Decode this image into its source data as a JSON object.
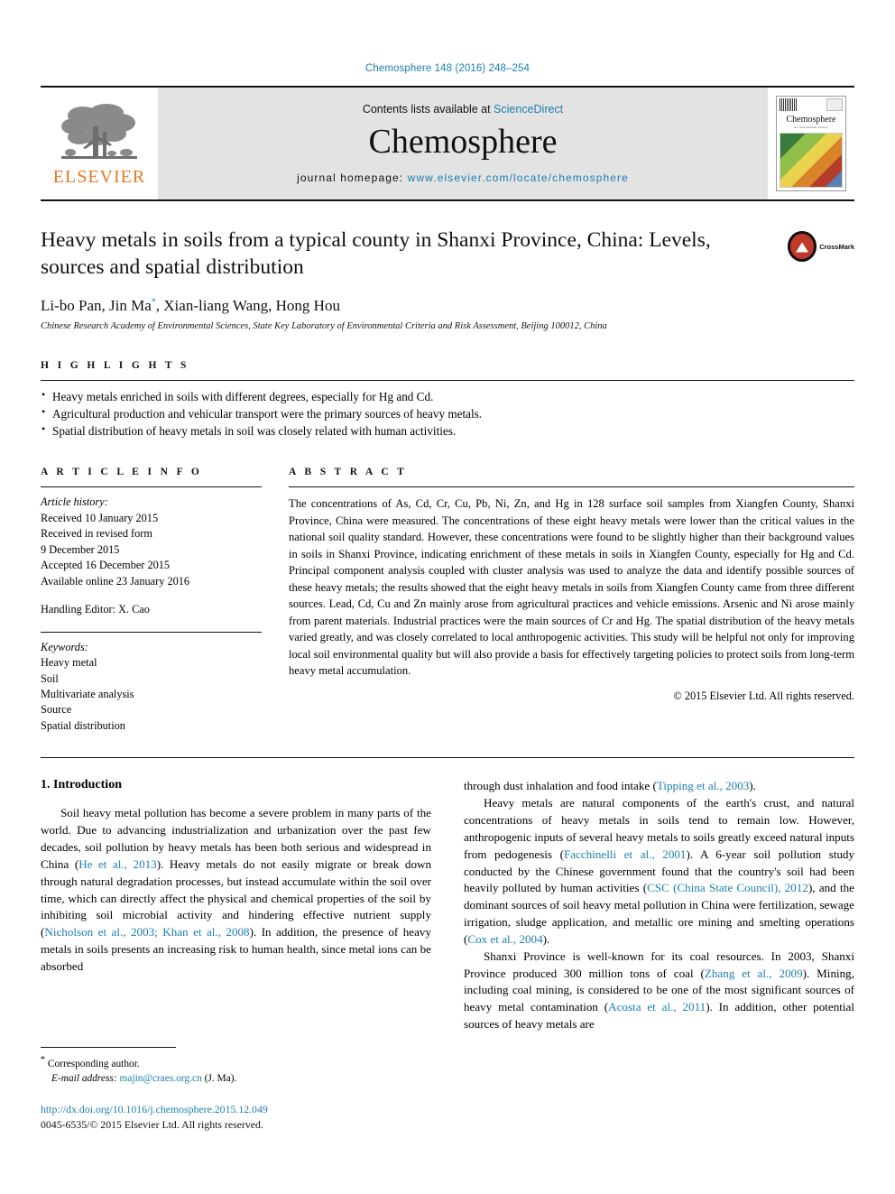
{
  "running_head": "Chemosphere 148 (2016) 248–254",
  "masthead": {
    "publisher_name": "ELSEVIER",
    "contents_prefix": "Contents lists available at ",
    "contents_link": "ScienceDirect",
    "journal_name": "Chemosphere",
    "homepage_prefix": "journal homepage: ",
    "homepage_url": "www.elsevier.com/locate/chemosphere",
    "cover_title": "Chemosphere",
    "cover_subtitle": "An International Journal"
  },
  "article": {
    "title": "Heavy metals in soils from a typical county in Shanxi Province, China: Levels, sources and spatial distribution",
    "authors": "Li-bo Pan, Jin Ma",
    "authors_tail": ", Xian-liang Wang, Hong Hou",
    "author_marker": "*",
    "affiliation": "Chinese Research Academy of Environmental Sciences, State Key Laboratory of Environmental Criteria and Risk Assessment, Beijing 100012, China",
    "crossmark_label": "CrossMark"
  },
  "highlights": {
    "label": "H I G H L I G H T S",
    "items": [
      "Heavy metals enriched in soils with different degrees, especially for Hg and Cd.",
      "Agricultural production and vehicular transport were the primary sources of heavy metals.",
      "Spatial distribution of heavy metals in soil was closely related with human activities."
    ]
  },
  "article_info": {
    "label": "A R T I C L E   I N F O",
    "history_label": "Article history:",
    "history": [
      "Received 10 January 2015",
      "Received in revised form",
      "9 December 2015",
      "Accepted 16 December 2015",
      "Available online 23 January 2016"
    ],
    "handling_editor": "Handling Editor: X. Cao",
    "keywords_label": "Keywords:",
    "keywords": [
      "Heavy metal",
      "Soil",
      "Multivariate analysis",
      "Source",
      "Spatial distribution"
    ]
  },
  "abstract": {
    "label": "A B S T R A C T",
    "text": "The concentrations of As, Cd, Cr, Cu, Pb, Ni, Zn, and Hg in 128 surface soil samples from Xiangfen County, Shanxi Province, China were measured. The concentrations of these eight heavy metals were lower than the critical values in the national soil quality standard. However, these concentrations were found to be slightly higher than their background values in soils in Shanxi Province, indicating enrichment of these metals in soils in Xiangfen County, especially for Hg and Cd. Principal component analysis coupled with cluster analysis was used to analyze the data and identify possible sources of these heavy metals; the results showed that the eight heavy metals in soils from Xiangfen County came from three different sources. Lead, Cd, Cu and Zn mainly arose from agricultural practices and vehicle emissions. Arsenic and Ni arose mainly from parent materials. Industrial practices were the main sources of Cr and Hg. The spatial distribution of the heavy metals varied greatly, and was closely correlated to local anthropogenic activities. This study will be helpful not only for improving local soil environmental quality but will also provide a basis for effectively targeting policies to protect soils from long-term heavy metal accumulation.",
    "copyright": "© 2015 Elsevier Ltd. All rights reserved."
  },
  "body": {
    "section_heading": "1. Introduction",
    "left_paragraphs": [
      {
        "indent": true,
        "segments": [
          {
            "t": "Soil heavy metal pollution has become a severe problem in many parts of the world. Due to advancing industrialization and urbanization over the past few decades, soil pollution by heavy metals has been both serious and widespread in China (",
            "link": false
          },
          {
            "t": "He et al., 2013",
            "link": true
          },
          {
            "t": "). Heavy metals do not easily migrate or break down through natural degradation processes, but instead accumulate within the soil over time, which can directly affect the physical and chemical properties of the soil by inhibiting soil microbial activity and hindering effective nutrient supply (",
            "link": false
          },
          {
            "t": "Nicholson et al., 2003; Khan et al., 2008",
            "link": true
          },
          {
            "t": "). In addition, the presence of heavy metals in soils presents an increasing risk to human health, since metal ions can be absorbed",
            "link": false
          }
        ]
      }
    ],
    "right_paragraphs": [
      {
        "indent": false,
        "segments": [
          {
            "t": "through dust inhalation and food intake (",
            "link": false
          },
          {
            "t": "Tipping et al., 2003",
            "link": true
          },
          {
            "t": ").",
            "link": false
          }
        ]
      },
      {
        "indent": true,
        "segments": [
          {
            "t": "Heavy metals are natural components of the earth's crust, and natural concentrations of heavy metals in soils tend to remain low. However, anthropogenic inputs of several heavy metals to soils greatly exceed natural inputs from pedogenesis (",
            "link": false
          },
          {
            "t": "Facchinelli et al., 2001",
            "link": true
          },
          {
            "t": "). A 6-year soil pollution study conducted by the Chinese government found that the country's soil had been heavily polluted by human activities (",
            "link": false
          },
          {
            "t": "CSC (China State Council), 2012",
            "link": true
          },
          {
            "t": "), and the dominant sources of soil heavy metal pollution in China were fertilization, sewage irrigation, sludge application, and metallic ore mining and smelting operations (",
            "link": false
          },
          {
            "t": "Cox et al., 2004",
            "link": true
          },
          {
            "t": ").",
            "link": false
          }
        ]
      },
      {
        "indent": true,
        "segments": [
          {
            "t": "Shanxi Province is well-known for its coal resources. In 2003, Shanxi Province produced 300 million tons of coal (",
            "link": false
          },
          {
            "t": "Zhang et al., 2009",
            "link": true
          },
          {
            "t": "). Mining, including coal mining, is considered to be one of the most significant sources of heavy metal contamination (",
            "link": false
          },
          {
            "t": "Acosta et al., 2011",
            "link": true
          },
          {
            "t": "). In addition, other potential sources of heavy metals are",
            "link": false
          }
        ]
      }
    ]
  },
  "footnotes": {
    "corresponding_marker": "*",
    "corresponding_label": "Corresponding author.",
    "email_label": "E-mail address:",
    "email": "majin@craes.org.cn",
    "email_suffix": "(J. Ma).",
    "doi": "http://dx.doi.org/10.1016/j.chemosphere.2015.12.049",
    "issn": "0045-6535/© 2015 Elsevier Ltd. All rights reserved."
  },
  "colors": {
    "link": "#1a7eb0",
    "elsevier_orange": "#E87722",
    "masthead_bg": "#e3e3e3"
  }
}
